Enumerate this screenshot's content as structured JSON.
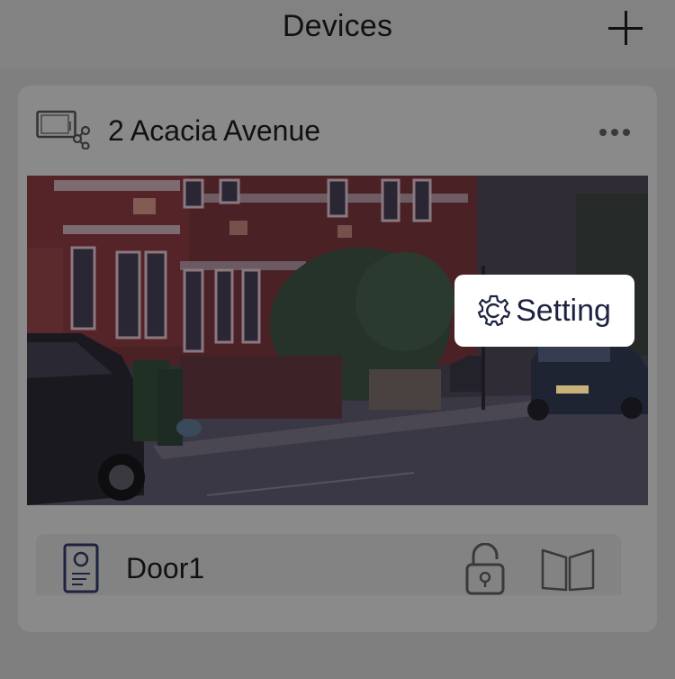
{
  "header": {
    "title": "Devices",
    "add_icon": "plus-icon"
  },
  "device": {
    "name": "2 Acacia Avenue",
    "type_icon": "monitor-share-icon",
    "more_icon": "more-dots-icon",
    "preview_alt": "Camera preview",
    "setting_label": "Setting",
    "setting_icon": "gear-icon"
  },
  "door": {
    "name": "Door1",
    "icon": "door-station-icon",
    "lock_icon": "unlock-icon",
    "gate_icon": "gate-icon"
  },
  "colors": {
    "overlay_dim": "#7f7f7f",
    "accent_text": "#1d2340"
  }
}
